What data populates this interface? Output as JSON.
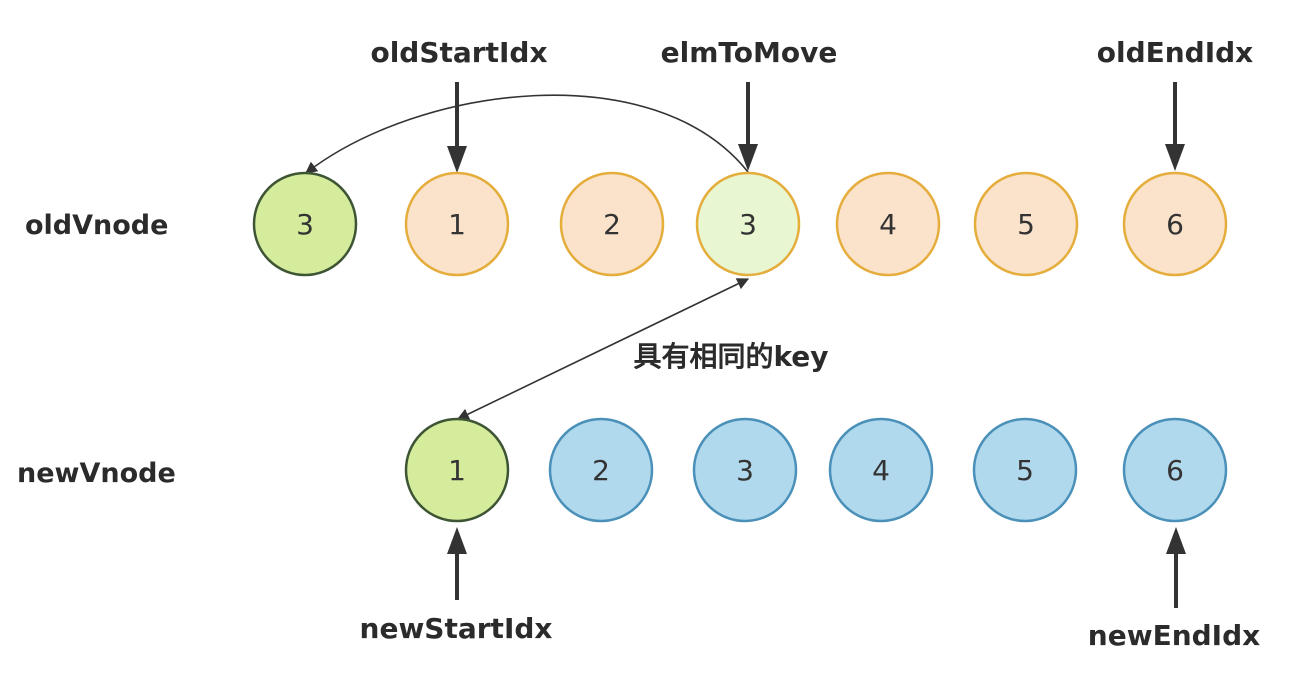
{
  "labels": {
    "old_row": "oldVnode",
    "new_row": "newVnode",
    "old_start": "oldStartIdx",
    "elm_to_move": "elmToMove",
    "old_end": "oldEndIdx",
    "new_start": "newStartIdx",
    "new_end": "newEndIdx",
    "same_key": "具有相同的key"
  },
  "colors": {
    "old_fill": "#fbe3cb",
    "old_stroke": "#e4ad3c",
    "new_fill": "#b1d9ee",
    "new_stroke": "#4a90b8",
    "moved_fill": "#d5ec9c",
    "moved_stroke": "#3e5535",
    "match_fill": "#e8f6d2",
    "match_stroke": "#e4ad3c"
  },
  "old_nodes": [
    {
      "text": "3",
      "style": "moved"
    },
    {
      "text": "1",
      "style": "old"
    },
    {
      "text": "2",
      "style": "old"
    },
    {
      "text": "3",
      "style": "match"
    },
    {
      "text": "4",
      "style": "old"
    },
    {
      "text": "5",
      "style": "old"
    },
    {
      "text": "6",
      "style": "old"
    }
  ],
  "new_nodes": [
    {
      "text": "1",
      "style": "moved"
    },
    {
      "text": "2",
      "style": "new"
    },
    {
      "text": "3",
      "style": "new"
    },
    {
      "text": "4",
      "style": "new"
    },
    {
      "text": "5",
      "style": "new"
    },
    {
      "text": "6",
      "style": "new"
    }
  ]
}
